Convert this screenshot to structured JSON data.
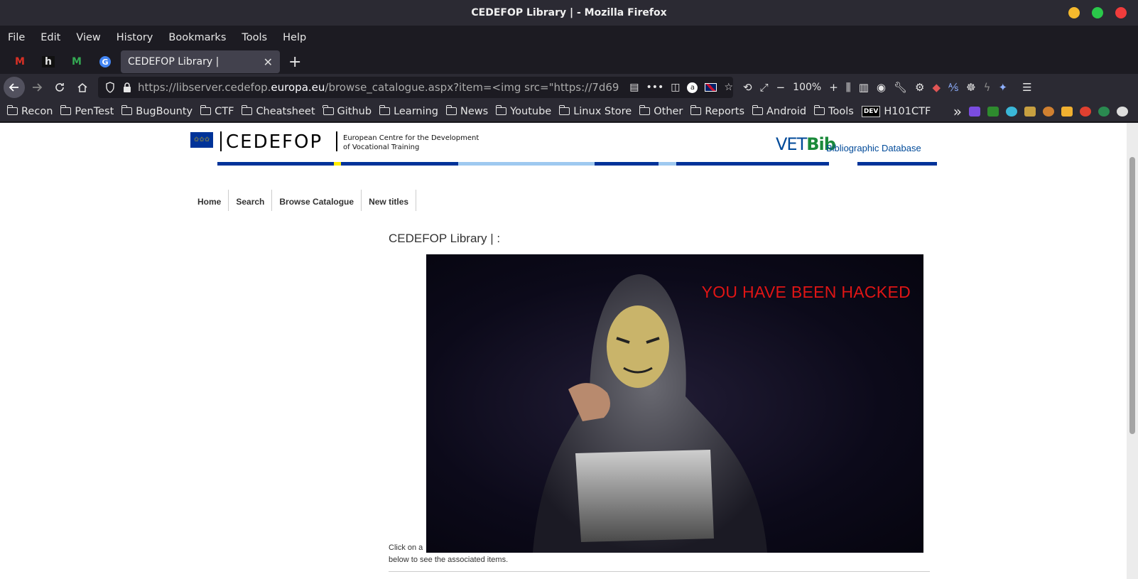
{
  "window": {
    "title": "CEDEFOP Library | - Mozilla Firefox",
    "controls": [
      "minimize",
      "maximize",
      "close"
    ],
    "control_colors": [
      "#f5b92d",
      "#2ac84a",
      "#f03c3c"
    ]
  },
  "menubar": {
    "items": [
      "File",
      "Edit",
      "View",
      "History",
      "Bookmarks",
      "Tools",
      "Help"
    ]
  },
  "tabs": {
    "pinned": [
      {
        "icon": "gmail-icon",
        "glyph": "M"
      },
      {
        "icon": "hackerone-icon",
        "glyph": "h"
      },
      {
        "icon": "gmail-icon",
        "glyph": "M"
      },
      {
        "icon": "google-icon",
        "glyph": "G"
      }
    ],
    "active_title": "CEDEFOP Library |",
    "close_glyph": "✕",
    "new_tab_glyph": "+"
  },
  "navbar": {
    "url_prefix": "https://libserver.cedefop.",
    "url_domain": "europa.eu",
    "url_suffix": "/browse_catalogue.aspx?item=<img src=\"https://7d696a",
    "zoom": "100%"
  },
  "bookmarks": {
    "items": [
      "Recon",
      "PenTest",
      "BugBounty",
      "CTF",
      "Cheatsheet",
      "Github",
      "Learning",
      "News",
      "Youtube",
      "Linux Store",
      "Other",
      "Reports",
      "Android",
      "Tools"
    ],
    "dev_item": "H101CTF",
    "dev_badge": "DEV",
    "overflow_glyph": "»"
  },
  "page": {
    "logo_word": "CEDEFOP",
    "logo_sub_line1": "European Centre for the Development",
    "logo_sub_line2": "of Vocational Training",
    "vetbib_vet": "VET",
    "vetbib_bib": "Bib",
    "vetbib_sub": "Bibliographic Database",
    "nav": [
      "Home",
      "Search",
      "Browse Catalogue",
      "New titles"
    ],
    "heading": "CEDEFOP Library | :",
    "image_text": "YOU HAVE BEEN HACKED",
    "caption_line1": "Click on a",
    "caption_line2": "below to see the associated items."
  },
  "colors": {
    "brand_blue": "#003399",
    "light_blue": "#9ec9f0",
    "yellow": "#ffed00",
    "vetbib_green": "#1a8a3a",
    "hack_red": "#e01515"
  }
}
